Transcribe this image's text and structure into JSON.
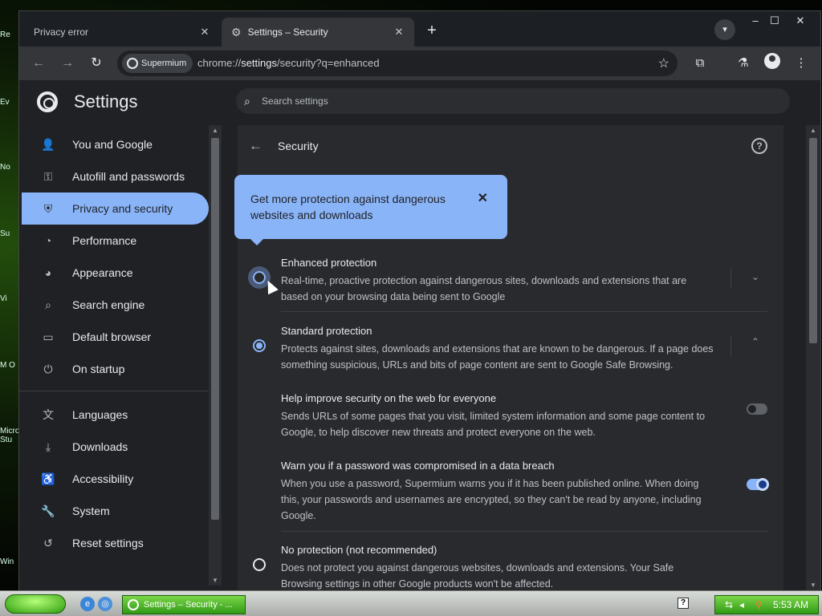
{
  "desktop": {
    "icons": [
      "Re",
      "Ev",
      "No",
      "Su",
      "Vi",
      "M O",
      "Micro Stu",
      "Win"
    ]
  },
  "browser": {
    "tabs": [
      {
        "label": "Privacy error"
      },
      {
        "label": "Settings – Security"
      }
    ],
    "new_tab_icon": "plus-icon",
    "omnibox": {
      "chip_label": "Supermium",
      "url_prefix": "chrome://",
      "url_host": "settings",
      "url_rest": "/security?q=enhanced"
    }
  },
  "settings": {
    "title": "Settings",
    "search_placeholder": "Search settings",
    "sidebar": {
      "items": [
        {
          "label": "You and Google",
          "icon": "person-icon"
        },
        {
          "label": "Autofill and passwords",
          "icon": "key-icon"
        },
        {
          "label": "Privacy and security",
          "icon": "shield-icon",
          "active": true
        },
        {
          "label": "Performance",
          "icon": "speedometer-icon"
        },
        {
          "label": "Appearance",
          "icon": "palette-icon"
        },
        {
          "label": "Search engine",
          "icon": "search-icon"
        },
        {
          "label": "Default browser",
          "icon": "browser-icon"
        },
        {
          "label": "On startup",
          "icon": "power-icon"
        }
      ],
      "advanced_items": [
        {
          "label": "Languages",
          "icon": "translate-icon"
        },
        {
          "label": "Downloads",
          "icon": "download-icon"
        },
        {
          "label": "Accessibility",
          "icon": "accessibility-icon"
        },
        {
          "label": "System",
          "icon": "wrench-icon"
        },
        {
          "label": "Reset settings",
          "icon": "reset-icon"
        }
      ]
    },
    "page": {
      "title": "Security",
      "callout": "Get more protection against dangerous websites and downloads",
      "options": [
        {
          "title": "Enhanced protection",
          "desc": "Real-time, proactive protection against dangerous sites, downloads and extensions that are based on your browsing data being sent to Google",
          "selected": false
        },
        {
          "title": "Standard protection",
          "desc": "Protects against sites, downloads and extensions that are known to be dangerous. If a page does something suspicious, URLs and bits of page content are sent to Google Safe Browsing.",
          "selected": true
        },
        {
          "title": "No protection (not recommended)",
          "desc": "Does not protect you against dangerous websites, downloads and extensions. Your Safe Browsing settings in other Google products won't be affected.",
          "selected": false
        }
      ],
      "sub_options": [
        {
          "title": "Help improve security on the web for everyone",
          "desc": "Sends URLs of some pages that you visit, limited system information and some page content to Google, to help discover new threats and protect everyone on the web.",
          "enabled": false
        },
        {
          "title": "Warn you if a password was compromised in a data breach",
          "desc": "When you use a password, Supermium warns you if it has been published online. When doing this, your passwords and usernames are encrypted, so they can't be read by anyone, including Google.",
          "enabled": true
        }
      ]
    }
  },
  "taskbar": {
    "task_label": "Settings – Security - ...",
    "time": "5:53 AM"
  }
}
